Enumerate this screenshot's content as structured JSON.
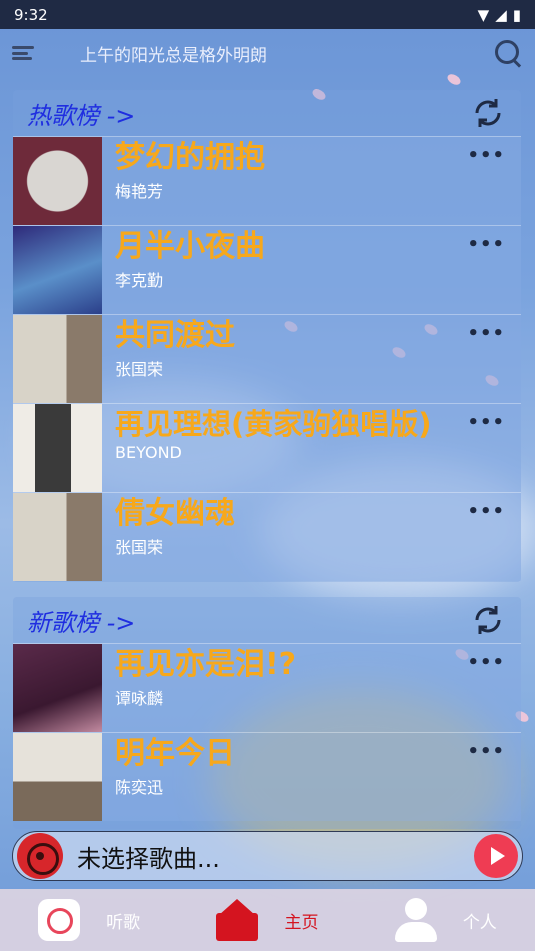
{
  "status_bar": {
    "time": "9:32"
  },
  "top_bar": {
    "title": "上午的阳光总是格外明朗"
  },
  "hot_chart": {
    "title": "热歌榜 ->",
    "songs": [
      {
        "title": "梦幻的拥抱",
        "artist": "梅艳芳",
        "cover_color": "#6e2a3a"
      },
      {
        "title": "月半小夜曲",
        "artist": "李克勤",
        "cover_color": "#3f3c9a"
      },
      {
        "title": "共同渡过",
        "artist": "张国荣",
        "cover_color": "#d8d3c8"
      },
      {
        "title": "再见理想(黄家驹独唱版)",
        "artist": "BEYOND",
        "cover_color": "#efece6"
      },
      {
        "title": "倩女幽魂",
        "artist": "张国荣",
        "cover_color": "#d8d3c8"
      }
    ]
  },
  "new_chart": {
    "title": "新歌榜 ->",
    "songs": [
      {
        "title": "再见亦是泪!?",
        "artist": "谭咏麟",
        "cover_color": "#5a2a4a"
      },
      {
        "title": "明年今日",
        "artist": "陈奕迅",
        "cover_color": "#e6e2da"
      }
    ]
  },
  "player": {
    "text": "未选择歌曲..."
  },
  "bottom_nav": {
    "items": [
      {
        "label": "听歌",
        "icon": "listen-icon"
      },
      {
        "label": "主页",
        "icon": "home-icon"
      },
      {
        "label": "个人",
        "icon": "user-icon"
      }
    ]
  },
  "colors": {
    "accent": "#d4141f",
    "song_title": "#f7a81b",
    "chart_title": "#1f2ee0"
  }
}
